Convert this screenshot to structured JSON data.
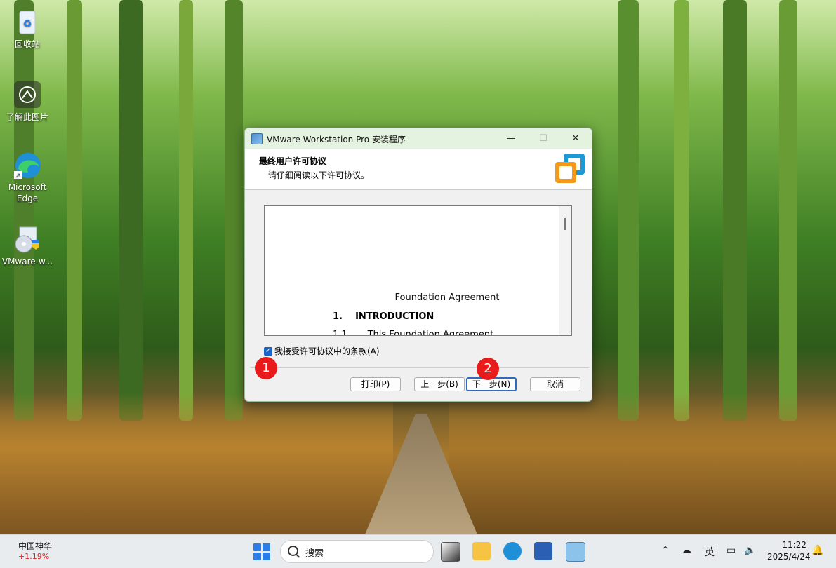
{
  "desktop": {
    "icons": [
      {
        "label": "回收站"
      },
      {
        "label": "了解此图片"
      },
      {
        "label": "Microsoft Edge"
      },
      {
        "label": "VMware-w..."
      }
    ]
  },
  "dialog": {
    "title": "VMware Workstation Pro 安装程序",
    "header_title": "最终用户许可协议",
    "header_subtitle": "请仔细阅读以下许可协议。",
    "license": {
      "doc_title": "Foundation Agreement",
      "section": "1.    INTRODUCTION",
      "subsection": "1.1       This Foundation Agreement"
    },
    "accept_label": "我接受许可协议中的条款(A)",
    "accept_checked": true,
    "buttons": {
      "print": "打印(P)",
      "back": "上一步(B)",
      "next": "下一步(N)",
      "cancel": "取消"
    },
    "window_controls": {
      "minimize": "—",
      "maximize": "☐",
      "close": "✕"
    }
  },
  "markers": [
    "1",
    "2"
  ],
  "taskbar": {
    "stock_name": "中国神华",
    "stock_change": "+1.19%",
    "search_placeholder": "搜索",
    "tray_language": "英",
    "time": "11:22",
    "date": "2025/4/24"
  },
  "colors": {
    "accent": "#1a64c8",
    "marker": "#e81a1a",
    "titlebar": "#e4f3df"
  }
}
